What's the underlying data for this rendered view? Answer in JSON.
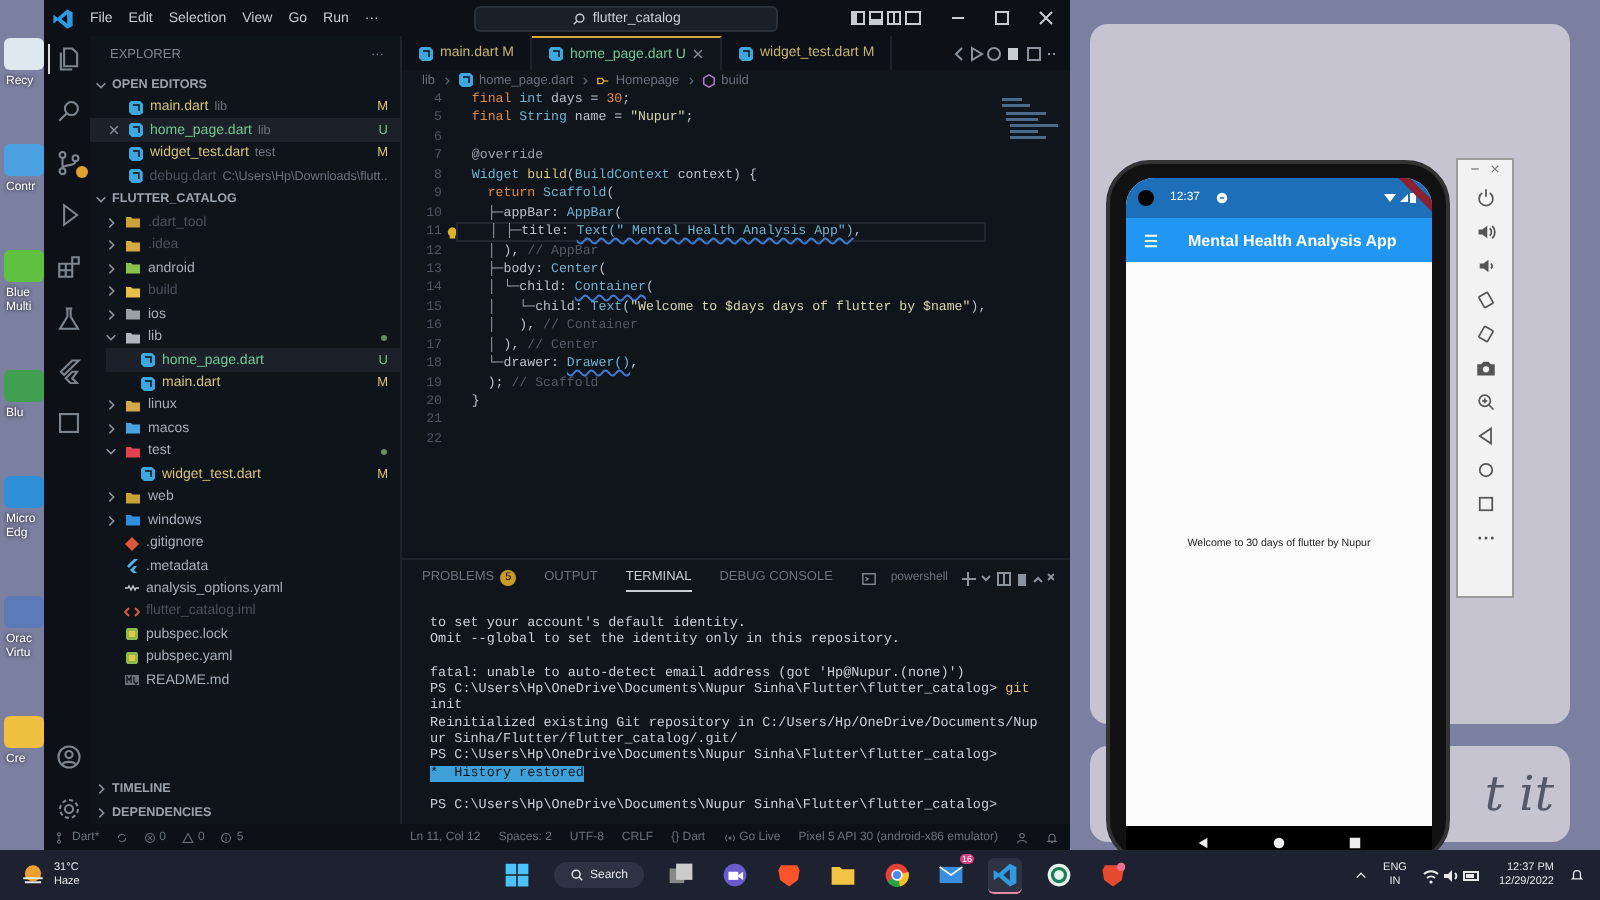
{
  "desktop": {
    "icons": [
      {
        "kind": "recycle",
        "label": "Recy"
      },
      {
        "kind": "control",
        "label": "Contr"
      },
      {
        "kind": "stack-multi",
        "label": "Blue Multi"
      },
      {
        "kind": "stack",
        "label": "Blu"
      },
      {
        "kind": "browser",
        "label": "Micro Edg"
      },
      {
        "kind": "cube",
        "label": "Orac Virtu"
      },
      {
        "kind": "folder",
        "label": "Cre"
      }
    ],
    "wallpaper_text": "t it"
  },
  "vscode": {
    "menu": [
      "File",
      "Edit",
      "Selection",
      "View",
      "Go",
      "Run",
      "···"
    ],
    "search": "flutter_catalog",
    "activity": [
      {
        "kind": "files",
        "selected": true
      },
      {
        "kind": "search",
        "selected": false
      },
      {
        "kind": "scm",
        "selected": false,
        "badge": true
      },
      {
        "kind": "run",
        "selected": false
      },
      {
        "kind": "extensions",
        "selected": false
      },
      {
        "kind": "testing",
        "selected": false
      },
      {
        "kind": "flutter",
        "selected": false
      },
      {
        "kind": "remote",
        "selected": false
      }
    ],
    "activity_bottom": [
      {
        "kind": "account"
      },
      {
        "kind": "settings"
      }
    ],
    "explorer": {
      "title": "EXPLORER",
      "more": "···",
      "open_editors": {
        "label": "OPEN EDITORS",
        "expanded": true,
        "items": [
          {
            "name": "main.dart",
            "path": "lib",
            "color": "#d6c27a",
            "status": "M",
            "selected": false
          },
          {
            "name": "home_page.dart",
            "path": "lib",
            "color": "#73c991",
            "status": "U",
            "selected": true
          },
          {
            "name": "widget_test.dart",
            "path": "test",
            "color": "#d6c27a",
            "status": "M",
            "selected": false
          },
          {
            "name": "debug.dart",
            "path": "C:\\Users\\Hp\\Downloads\\flutt...",
            "color": "#4b525c",
            "selected": false
          }
        ]
      },
      "project": {
        "label": "FLUTTER_CATALOG",
        "expanded": true,
        "children": [
          {
            "kind": "folder",
            "name": ".dart_tool",
            "color": "#c9a23a",
            "dim": true,
            "expanded": false,
            "selected": false
          },
          {
            "kind": "folder",
            "name": ".idea",
            "color": "#d6a840",
            "dim": true,
            "expanded": false,
            "selected": false
          },
          {
            "kind": "folder",
            "name": "android",
            "color": "#8bc34a",
            "dim": false,
            "expanded": false,
            "selected": false
          },
          {
            "kind": "folder",
            "name": "build",
            "color": "#e8c047",
            "dim": true,
            "expanded": false,
            "selected": false
          },
          {
            "kind": "folder",
            "name": "ios",
            "color": "#9aa0a6",
            "dim": false,
            "expanded": false,
            "selected": false
          },
          {
            "kind": "folder",
            "name": "lib",
            "color": "#b0b6bd",
            "dim": false,
            "dot": true,
            "expanded": true,
            "selected": false,
            "children": [
              {
                "kind": "dart",
                "name": "home_page.dart",
                "color": "#73c991",
                "status": "U",
                "selected": true
              },
              {
                "kind": "dart",
                "name": "main.dart",
                "color": "#d6c27a",
                "status": "M",
                "selected": false
              }
            ]
          },
          {
            "kind": "folder",
            "name": "linux",
            "color": "#d4a84a",
            "dim": false,
            "expanded": false,
            "selected": false
          },
          {
            "kind": "folder",
            "name": "macos",
            "color": "#4aa3df",
            "dim": false,
            "expanded": false,
            "selected": false
          },
          {
            "kind": "folder",
            "name": "test",
            "color": "#e0424f",
            "dim": false,
            "dot": true,
            "expanded": true,
            "selected": false,
            "children": [
              {
                "kind": "dart",
                "name": "widget_test.dart",
                "color": "#d6c27a",
                "status": "M",
                "selected": false
              }
            ]
          },
          {
            "kind": "folder",
            "name": "web",
            "color": "#c9a23a",
            "dim": false,
            "expanded": false,
            "selected": false
          },
          {
            "kind": "folder",
            "name": "windows",
            "color": "#2f8ee0",
            "dim": false,
            "expanded": false,
            "selected": false
          },
          {
            "kind": "git",
            "name": ".gitignore",
            "color": "#a6b0ba",
            "selected": false
          },
          {
            "kind": "flutter",
            "name": ".metadata",
            "color": "#a6b0ba",
            "selected": false
          },
          {
            "kind": "yaml",
            "name": "analysis_options.yaml",
            "color": "#a6b0ba",
            "selected": false
          },
          {
            "kind": "xml",
            "name": "flutter_catalog.iml",
            "color": "#4b525c",
            "selected": false
          },
          {
            "kind": "pub",
            "name": "pubspec.lock",
            "color": "#a6b0ba",
            "selected": false
          },
          {
            "kind": "pub",
            "name": "pubspec.yaml",
            "color": "#a6b0ba",
            "selected": false
          },
          {
            "kind": "md",
            "name": "README.md",
            "color": "#a6b0ba",
            "selected": false
          }
        ]
      },
      "sections": [
        {
          "label": "TIMELINE",
          "expanded": false
        },
        {
          "label": "DEPENDENCIES",
          "expanded": false
        }
      ]
    },
    "tabs": [
      {
        "name": "main.dart",
        "status": "M",
        "color": "#c8b46f",
        "selected": false
      },
      {
        "name": "home_page.dart",
        "status": "U",
        "color": "#73c991",
        "selected": true
      },
      {
        "name": "widget_test.dart",
        "status": "M",
        "color": "#c8b46f",
        "selected": false
      }
    ],
    "breadcrumb": [
      {
        "kind": "folder",
        "text": "lib"
      },
      {
        "kind": "dart",
        "text": "home_page.dart"
      },
      {
        "kind": "class",
        "text": "Homepage"
      },
      {
        "kind": "method",
        "text": "build"
      }
    ],
    "code": [
      {
        "number": "4",
        "tokens": [
          {
            "kind": "kw",
            "text": "  final "
          },
          {
            "kind": "type",
            "text": "int "
          },
          {
            "kind": "plain",
            "text": "days = "
          },
          {
            "kind": "num",
            "text": "30"
          },
          {
            "kind": "plain",
            "text": ";"
          }
        ]
      },
      {
        "number": "5",
        "tokens": [
          {
            "kind": "kw",
            "text": "  final "
          },
          {
            "kind": "type",
            "text": "String "
          },
          {
            "kind": "plain",
            "text": "name = "
          },
          {
            "kind": "str",
            "text": "\"Nupur\""
          },
          {
            "kind": "plain",
            "text": ";"
          }
        ]
      },
      {
        "number": "6"
      },
      {
        "number": "7",
        "tokens": [
          {
            "kind": "meta",
            "text": "  @override"
          }
        ]
      },
      {
        "number": "8",
        "tokens": [
          {
            "kind": "type",
            "text": "  Widget "
          },
          {
            "kind": "fn",
            "text": "build"
          },
          {
            "kind": "plain",
            "text": "("
          },
          {
            "kind": "type",
            "text": "BuildContext"
          },
          {
            "kind": "plain",
            "text": " context) {"
          }
        ]
      },
      {
        "number": "9",
        "tokens": [
          {
            "kind": "kw",
            "text": "    return "
          },
          {
            "kind": "type",
            "text": "Scaffold"
          },
          {
            "kind": "plain",
            "text": "("
          }
        ]
      },
      {
        "number": "10",
        "tokens": [
          {
            "kind": "guide",
            "text": "    ├─"
          },
          {
            "kind": "plain",
            "text": "appBar: "
          },
          {
            "kind": "type",
            "text": "AppBar"
          },
          {
            "kind": "plain",
            "text": "("
          }
        ]
      },
      {
        "number": "11",
        "current": true,
        "lightbulb": true,
        "tokens": [
          {
            "kind": "guide",
            "text": "    │ ├─"
          },
          {
            "kind": "plain",
            "text": "title: "
          },
          {
            "kind": "hint",
            "text": "Text(\" Mental Health Analysis App\")"
          },
          {
            "kind": "plain",
            "text": ","
          }
        ]
      },
      {
        "number": "12",
        "tokens": [
          {
            "kind": "guide",
            "text": "    │ "
          },
          {
            "kind": "plain",
            "text": "), "
          },
          {
            "kind": "comment",
            "text": "// AppBar"
          }
        ]
      },
      {
        "number": "13",
        "tokens": [
          {
            "kind": "guide",
            "text": "    ├─"
          },
          {
            "kind": "plain",
            "text": "body: "
          },
          {
            "kind": "type",
            "text": "Center"
          },
          {
            "kind": "plain",
            "text": "("
          }
        ]
      },
      {
        "number": "14",
        "tokens": [
          {
            "kind": "guide",
            "text": "    │ └─"
          },
          {
            "kind": "plain",
            "text": "child: "
          },
          {
            "kind": "hint",
            "text": "Container"
          },
          {
            "kind": "plain",
            "text": "("
          }
        ]
      },
      {
        "number": "15",
        "tokens": [
          {
            "kind": "guide",
            "text": "    │   └─"
          },
          {
            "kind": "plain",
            "text": "child: "
          },
          {
            "kind": "type",
            "text": "Text"
          },
          {
            "kind": "plain",
            "text": "("
          },
          {
            "kind": "str",
            "text": "\"Welcome to $days days of flutter by $name\""
          },
          {
            "kind": "plain",
            "text": "),"
          }
        ]
      },
      {
        "number": "16",
        "tokens": [
          {
            "kind": "guide",
            "text": "    │   "
          },
          {
            "kind": "plain",
            "text": "), "
          },
          {
            "kind": "comment",
            "text": "// Container"
          }
        ]
      },
      {
        "number": "17",
        "tokens": [
          {
            "kind": "guide",
            "text": "    │ "
          },
          {
            "kind": "plain",
            "text": "), "
          },
          {
            "kind": "comment",
            "text": "// Center"
          }
        ]
      },
      {
        "number": "18",
        "tokens": [
          {
            "kind": "guide",
            "text": "    └─"
          },
          {
            "kind": "plain",
            "text": "drawer: "
          },
          {
            "kind": "hint",
            "text": "Drawer()"
          },
          {
            "kind": "plain",
            "text": ","
          }
        ]
      },
      {
        "number": "19",
        "tokens": [
          {
            "kind": "plain",
            "text": "    ); "
          },
          {
            "kind": "comment",
            "text": "// Scaffold"
          }
        ]
      },
      {
        "number": "20",
        "tokens": [
          {
            "kind": "plain",
            "text": "  }"
          }
        ]
      },
      {
        "number": "21"
      },
      {
        "number": "22"
      }
    ],
    "panel": {
      "tabs": [
        {
          "label": "PROBLEMS",
          "count": "5",
          "selected": false
        },
        {
          "label": "OUTPUT",
          "selected": false
        },
        {
          "label": "TERMINAL",
          "selected": true
        },
        {
          "label": "DEBUG CONSOLE",
          "selected": false
        }
      ],
      "shell": "powershell",
      "terminal": [
        {
          "kind": "text",
          "segments": [
            {
              "kind": "plain",
              "text": "to set your account's default identity."
            }
          ]
        },
        {
          "kind": "text",
          "segments": [
            {
              "kind": "plain",
              "text": "Omit --global to set the identity only in this repository."
            }
          ]
        },
        {
          "kind": "blank"
        },
        {
          "kind": "text",
          "segments": [
            {
              "kind": "plain",
              "text": "fatal: unable to auto-detect email address (got 'Hp@Nupur.(none)')"
            }
          ]
        },
        {
          "kind": "text",
          "segments": [
            {
              "kind": "plain",
              "text": "PS C:\\Users\\Hp\\OneDrive\\Documents\\Nupur Sinha\\Flutter\\flutter_catalog> "
            },
            {
              "kind": "cmd",
              "text": "git"
            }
          ]
        },
        {
          "kind": "text",
          "segments": [
            {
              "kind": "plain",
              "text": "init"
            }
          ]
        },
        {
          "kind": "text",
          "segments": [
            {
              "kind": "plain",
              "text": "Reinitialized existing Git repository in C:/Users/Hp/OneDrive/Documents/Nup"
            }
          ]
        },
        {
          "kind": "text",
          "segments": [
            {
              "kind": "plain",
              "text": "ur Sinha/Flutter/flutter_catalog/.git/"
            }
          ]
        },
        {
          "kind": "text",
          "segments": [
            {
              "kind": "plain",
              "text": "PS C:\\Users\\Hp\\OneDrive\\Documents\\Nupur Sinha\\Flutter\\flutter_catalog>"
            }
          ]
        },
        {
          "kind": "text",
          "segments": [
            {
              "kind": "highlight",
              "text": "*  History restored"
            }
          ]
        },
        {
          "kind": "blank"
        },
        {
          "kind": "text",
          "segments": [
            {
              "kind": "plain",
              "text": "PS C:\\Users\\Hp\\OneDrive\\Documents\\Nupur Sinha\\Flutter\\flutter_catalog>"
            }
          ]
        }
      ]
    },
    "status_bar": {
      "left": [
        {
          "kind": "branch",
          "text": "Dart*"
        },
        {
          "kind": "sync"
        },
        {
          "kind": "error",
          "text": "0"
        },
        {
          "kind": "warning",
          "text": "0"
        },
        {
          "kind": "info",
          "text": "5"
        }
      ],
      "right": [
        {
          "kind": "text",
          "text": "Ln 11, Col 12"
        },
        {
          "kind": "text",
          "text": "Spaces: 2"
        },
        {
          "kind": "text",
          "text": "UTF-8"
        },
        {
          "kind": "text",
          "text": "CRLF"
        },
        {
          "kind": "text",
          "text": "{} Dart"
        },
        {
          "kind": "live",
          "text": "Go Live"
        },
        {
          "kind": "text",
          "text": "Pixel 5 API 30 (android-x86 emulator)"
        },
        {
          "kind": "feedback"
        },
        {
          "kind": "bell"
        }
      ]
    }
  },
  "phone": {
    "time": "12:37",
    "app_title": "Mental Health Analysis App",
    "body_text": "Welcome to 30 days of flutter by Nupur"
  },
  "emulator_tools": [
    {
      "kind": "power"
    },
    {
      "kind": "volume-up"
    },
    {
      "kind": "volume-down"
    },
    {
      "kind": "rotate-left"
    },
    {
      "kind": "rotate-right"
    },
    {
      "kind": "camera"
    },
    {
      "kind": "zoom"
    },
    {
      "kind": "back"
    },
    {
      "kind": "home"
    },
    {
      "kind": "overview"
    },
    {
      "kind": "more"
    }
  ],
  "taskbar": {
    "weather": {
      "temp": "31°C",
      "condition": "Haze"
    },
    "apps": [
      {
        "kind": "start",
        "selected": false
      },
      {
        "kind": "search",
        "label": "Search",
        "selected": false
      },
      {
        "kind": "taskview",
        "selected": false
      },
      {
        "kind": "meet",
        "selected": false
      },
      {
        "kind": "brave",
        "selected": false
      },
      {
        "kind": "files",
        "selected": false
      },
      {
        "kind": "chrome",
        "selected": false
      },
      {
        "kind": "mail",
        "badge": "16",
        "selected": false
      },
      {
        "kind": "vscode",
        "selected": true
      },
      {
        "kind": "app",
        "selected": false
      },
      {
        "kind": "brave-beta",
        "selected": false
      }
    ],
    "language": [
      "ENG",
      "IN"
    ],
    "time": "12:37 PM",
    "date": "12/29/2022"
  }
}
